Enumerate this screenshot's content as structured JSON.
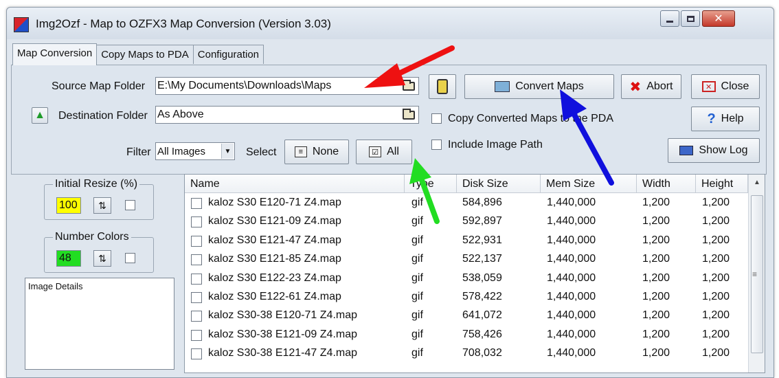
{
  "window": {
    "title": "Img2Ozf - Map to OZFX3 Map Conversion (Version 3.03)"
  },
  "tabs": [
    {
      "label": "Map Conversion"
    },
    {
      "label": "Copy Maps to PDA"
    },
    {
      "label": "Configuration"
    }
  ],
  "form": {
    "source_label": "Source Map Folder",
    "source_value": "E:\\My Documents\\Downloads\\Maps",
    "dest_label": "Destination Folder",
    "dest_value": "As Above",
    "filter_label": "Filter",
    "filter_value": "All Images",
    "select_label": "Select",
    "none_button": "None",
    "all_button": "All"
  },
  "actions": {
    "convert": "Convert Maps",
    "abort": "Abort",
    "close": "Close",
    "help": "Help",
    "show_log": "Show Log",
    "copy_to_pda": "Copy Converted Maps to the PDA",
    "include_path": "Include Image Path"
  },
  "settings": {
    "resize_label": "Initial Resize (%)",
    "resize_value": "100",
    "colors_label": "Number Colors",
    "colors_value": "48",
    "details_label": "Image Details"
  },
  "table": {
    "columns": [
      "Name",
      "Type",
      "Disk Size",
      "Mem Size",
      "Width",
      "Height"
    ],
    "rows": [
      {
        "name": "kaloz S30 E120-71 Z4.map",
        "type": "gif",
        "disk": "584,896",
        "mem": "1,440,000",
        "width": "1,200",
        "height": "1,200"
      },
      {
        "name": "kaloz S30 E121-09 Z4.map",
        "type": "gif",
        "disk": "592,897",
        "mem": "1,440,000",
        "width": "1,200",
        "height": "1,200"
      },
      {
        "name": "kaloz S30 E121-47 Z4.map",
        "type": "gif",
        "disk": "522,931",
        "mem": "1,440,000",
        "width": "1,200",
        "height": "1,200"
      },
      {
        "name": "kaloz S30 E121-85 Z4.map",
        "type": "gif",
        "disk": "522,137",
        "mem": "1,440,000",
        "width": "1,200",
        "height": "1,200"
      },
      {
        "name": "kaloz S30 E122-23 Z4.map",
        "type": "gif",
        "disk": "538,059",
        "mem": "1,440,000",
        "width": "1,200",
        "height": "1,200"
      },
      {
        "name": "kaloz S30 E122-61 Z4.map",
        "type": "gif",
        "disk": "578,422",
        "mem": "1,440,000",
        "width": "1,200",
        "height": "1,200"
      },
      {
        "name": "kaloz S30-38 E120-71 Z4.map",
        "type": "gif",
        "disk": "641,072",
        "mem": "1,440,000",
        "width": "1,200",
        "height": "1,200"
      },
      {
        "name": "kaloz S30-38 E121-09 Z4.map",
        "type": "gif",
        "disk": "758,426",
        "mem": "1,440,000",
        "width": "1,200",
        "height": "1,200"
      },
      {
        "name": "kaloz S30-38 E121-47 Z4.map",
        "type": "gif",
        "disk": "708,032",
        "mem": "1,440,000",
        "width": "1,200",
        "height": "1,200"
      }
    ]
  },
  "colors": {
    "resize_field_bg": "#ffff00",
    "colors_field_bg": "#22dd22",
    "arrow_red": "#ee1111",
    "arrow_blue": "#1010dd",
    "arrow_green": "#22dd22"
  },
  "icons": {
    "source_browse": "folder-icon",
    "dest_browse": "folder-icon",
    "dest_up": "up-arrow-icon",
    "clipboard": "clipboard-icon",
    "convert": "maps-convert-icon",
    "abort": "x-icon",
    "close": "close-window-icon",
    "help": "question-icon",
    "show_log": "log-table-icon",
    "none": "deselect-icon",
    "all": "select-all-icon"
  }
}
